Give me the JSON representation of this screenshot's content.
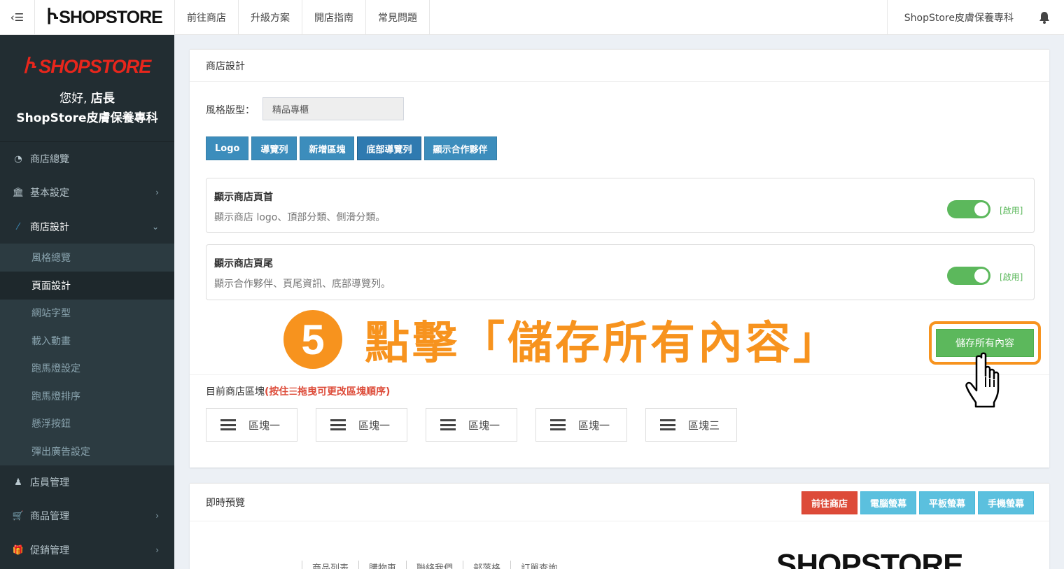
{
  "topbar": {
    "toggle_icon": "menu-icon",
    "brand": "SHOPSTORE",
    "nav": [
      "前往商店",
      "升級方案",
      "開店指南",
      "常見問題"
    ],
    "shop_name": "ShopStore皮膚保養專科",
    "bell_icon": "bell-icon"
  },
  "sidebar": {
    "logo": "SHOPSTORE",
    "greeting_prefix": "您好, ",
    "greeting_name": "店長",
    "shop_name": "ShopStore皮膚保養專科",
    "menu": [
      {
        "label": "商店總覽",
        "icon": "dashboard-icon"
      },
      {
        "label": "基本設定",
        "icon": "bank-icon"
      },
      {
        "label": "商店設計",
        "icon": "magic-wand-icon"
      }
    ],
    "submenu": [
      "風格總覽",
      "頁面設計",
      "網站字型",
      "載入動畫",
      "跑馬燈設定",
      "跑馬燈排序",
      "懸浮按鈕",
      "彈出廣告設定"
    ],
    "menu_bottom": [
      {
        "label": "店員管理",
        "icon": "user-secret-icon"
      },
      {
        "label": "商品管理",
        "icon": "cart-icon"
      },
      {
        "label": "促銷管理",
        "icon": "gift-icon"
      }
    ]
  },
  "design": {
    "title": "商店設計",
    "style_label": "風格版型：",
    "style_value": "精品專櫃",
    "buttons": [
      "Logo",
      "導覽列",
      "新增區塊",
      "底部導覽列",
      "顯示合作夥伴"
    ],
    "header_toggle": {
      "title": "顯示商店頁首",
      "desc": "顯示商店 logo、頂部分類、側滑分類。",
      "state": "[啟用]"
    },
    "footer_toggle": {
      "title": "顯示商店頁尾",
      "desc": "顯示合作夥伴、頁尾資訊、底部導覽列。",
      "state": "[啟用]"
    },
    "save_label": "儲存所有內容",
    "blocks_label": "目前商店區塊",
    "blocks_hint": "(按住☰拖曳可更改區塊順序)",
    "blocks": [
      "區塊一",
      "區塊一",
      "區塊一",
      "區塊一",
      "區塊三"
    ]
  },
  "annotation": {
    "step": "5",
    "text": "點擊「儲存所有內容」"
  },
  "preview": {
    "title": "即時預覽",
    "buttons": [
      "前往商店",
      "電腦螢幕",
      "平板螢幕",
      "手機螢幕"
    ],
    "nav": [
      "商品列表",
      "購物車",
      "聯絡我們",
      "部落格",
      "訂單查詢"
    ],
    "logo": "SHOPSTORE"
  },
  "colors": {
    "sidebar_bg": "#222d32",
    "primary": "#3c8dbc",
    "success": "#5cb85c",
    "danger": "#dd4b39",
    "info": "#5bc0de",
    "annotation": "#f7931e"
  }
}
